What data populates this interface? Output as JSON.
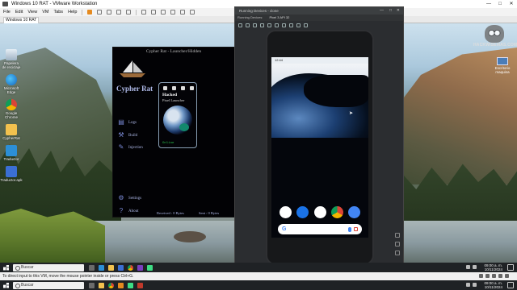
{
  "vmware": {
    "title": "Windows 10 RAT - VMware Workstation",
    "menu": [
      "File",
      "Edit",
      "View",
      "VM",
      "Tabs",
      "Help"
    ],
    "tab": "Windows 10 RAT",
    "status_text": "To direct input to this VM, move the mouse pointer inside or press Ctrl+G.",
    "window_controls": {
      "minimize": "—",
      "maximize": "□",
      "close": "✕"
    }
  },
  "desktop": {
    "icons": [
      {
        "label": "Papelera de reciclaje",
        "icon": "recycle-bin-icon"
      },
      {
        "label": "Microsoft Edge",
        "icon": "edge-icon"
      },
      {
        "label": "Google Chrome",
        "icon": "chrome-icon"
      },
      {
        "label": "CypherRat",
        "icon": "folder-icon"
      },
      {
        "label": "Traductor",
        "icon": "app-icon"
      },
      {
        "label": "Traductor.apk",
        "icon": "exe-icon"
      }
    ],
    "watermark_text": "HACKWISEMAS.COM",
    "pc_widget_label": "Escritorio maquina"
  },
  "cypher_rat": {
    "title": "Cypher Rat - Launcher/Hidden",
    "heading": "Cypher Rat",
    "menu": [
      {
        "label": "Logs",
        "icon": "logs-icon",
        "glyph": "▤"
      },
      {
        "label": "Build",
        "icon": "build-icon",
        "glyph": "⚒"
      },
      {
        "label": "Injection",
        "icon": "injection-icon",
        "glyph": "✎"
      }
    ],
    "phone_card": {
      "title": "Hacked",
      "subtitle": "Pixel Launcher",
      "status": "Online"
    },
    "settings_label": "Settings",
    "about_label": "About",
    "received": "Received : 0 Bytes",
    "sent": "Sent : 0 Bytes"
  },
  "emulator": {
    "title": "Running Devices - clone",
    "tabs_label": "Running Devices:",
    "device_tab": "Pixel 3 API 32",
    "window_controls": {
      "minimize": "—",
      "maximize": "□",
      "close": "✕"
    },
    "phone_status_time": "12:44",
    "search_glyph": "G",
    "dock": [
      "phone-icon",
      "messages-icon",
      "play-store-icon",
      "chrome-icon",
      "camera-icon"
    ]
  },
  "taskbar": {
    "search_placeholder": "Buscar",
    "clock_time": "09:00 a. m.",
    "clock_date": "10/11/2024"
  },
  "host_taskbar": {
    "search_placeholder": "Buscar",
    "clock_time": "09:00 a. m.",
    "clock_date": "10/11/2024"
  },
  "colors": {
    "accent": "#aeb9e8",
    "online": "#2ac24a",
    "vm_orange": "#e58a1f"
  }
}
